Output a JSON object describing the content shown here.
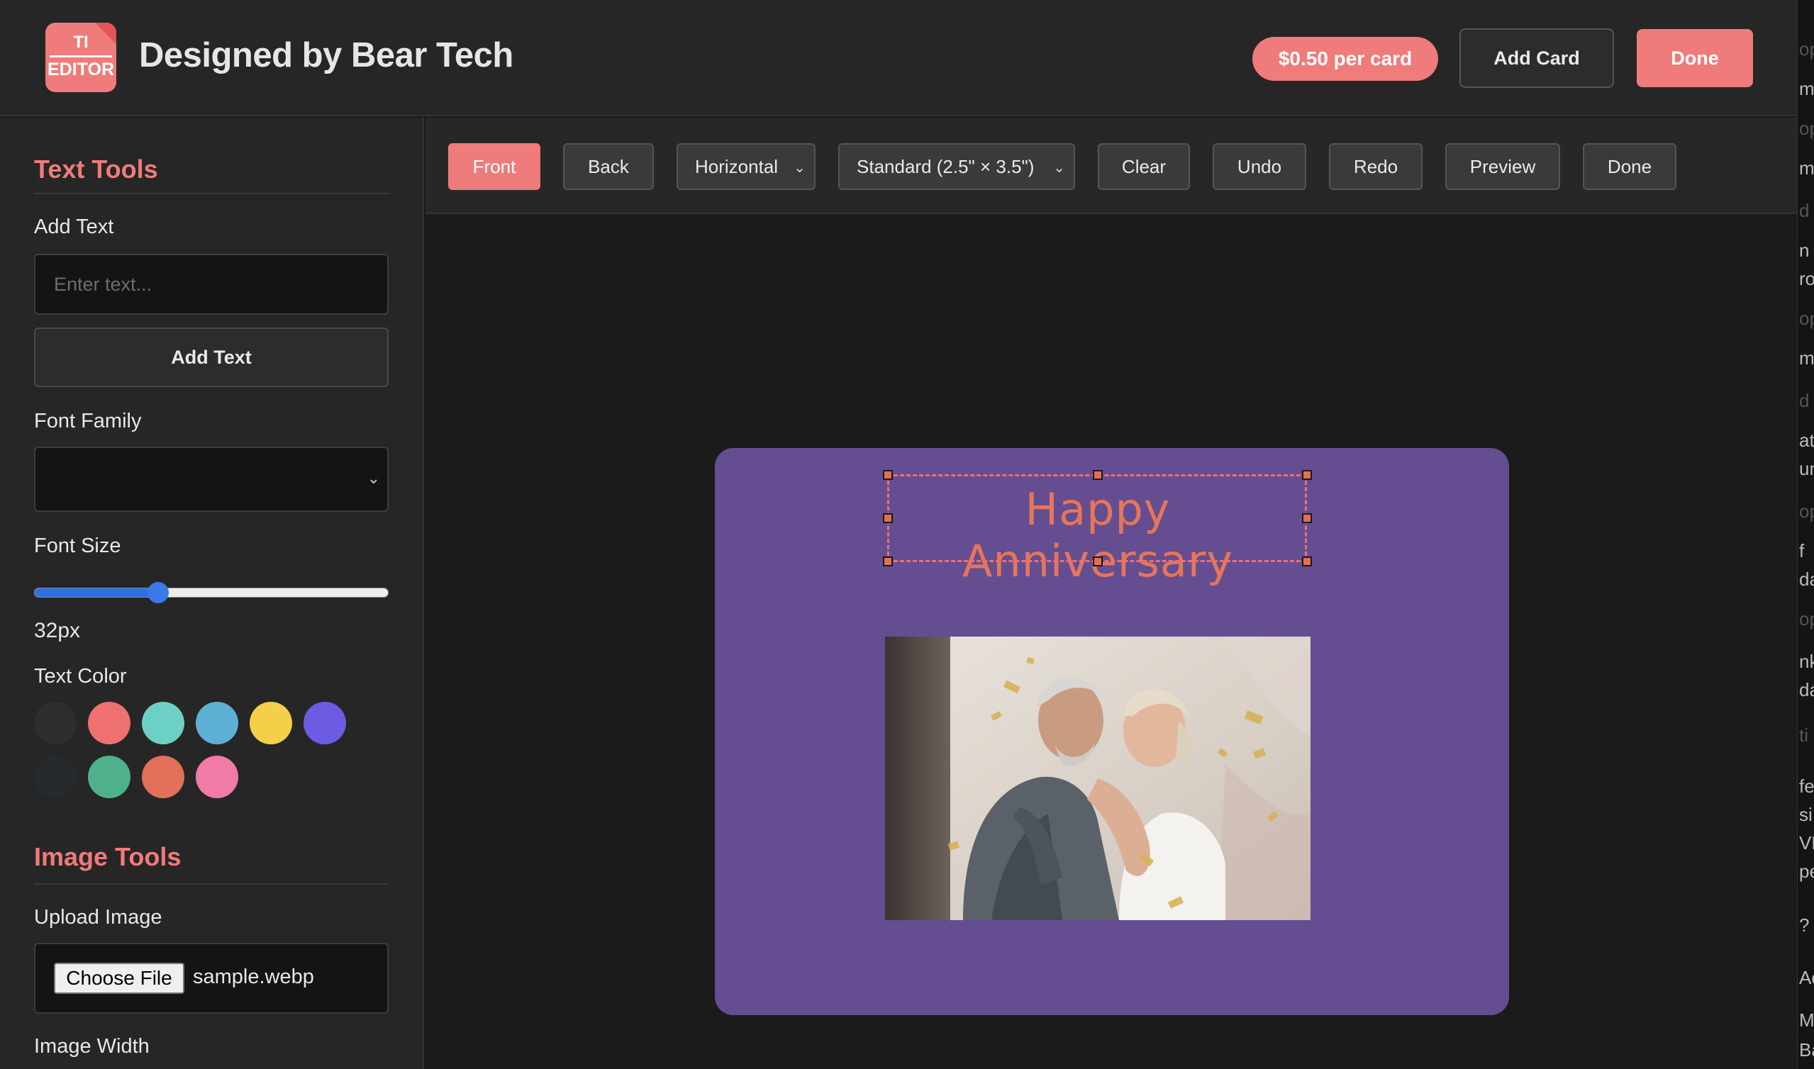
{
  "header": {
    "logo_line1": "TI",
    "logo_line2": "EDITOR",
    "title": "Designed by Bear Tech",
    "price_label": "$0.50 per card",
    "add_card_label": "Add Card",
    "done_label": "Done",
    "accent_color": "#ef7b7b"
  },
  "sidebar": {
    "text_tools": {
      "title": "Text Tools",
      "add_text_label": "Add Text",
      "text_input_value": "",
      "text_input_placeholder": "Enter text...",
      "add_text_button": "Add Text",
      "font_family_label": "Font Family",
      "font_family_value": "",
      "font_size_label": "Font Size",
      "font_size_fraction": 0.35,
      "font_size_value": "32px",
      "text_color_label": "Text Color",
      "colors": [
        "#2e2e2e",
        "#ef7070",
        "#6dd0c4",
        "#5db0d3",
        "#f4cf49",
        "#6c5be3",
        "#252a2e",
        "#4fb18b",
        "#e2705a",
        "#f07aa8"
      ]
    },
    "image_tools": {
      "title": "Image Tools",
      "upload_label": "Upload Image",
      "choose_file_label": "Choose File",
      "file_name": "sample.webp",
      "image_width_label": "Image Width"
    }
  },
  "toolbar": {
    "front": "Front",
    "back": "Back",
    "orientation": "Horizontal",
    "card_size": "Standard (2.5\" × 3.5\")",
    "clear": "Clear",
    "undo": "Undo",
    "redo": "Redo",
    "preview": "Preview",
    "done": "Done"
  },
  "canvas": {
    "card_color": "#654d91",
    "card_text": "Happy Anniversary",
    "card_text_color": "#e5765a"
  },
  "right_strip": {
    "fragments": [
      "op",
      "m",
      "op",
      "m",
      "d",
      "n",
      "ro",
      "op",
      "m",
      "d",
      "at",
      "un",
      "op",
      "f",
      "da",
      "op",
      "nk",
      "da",
      "ti",
      "fe",
      "si",
      "VL",
      "pe",
      "?",
      "Ac",
      "Mo",
      "Ba"
    ]
  }
}
